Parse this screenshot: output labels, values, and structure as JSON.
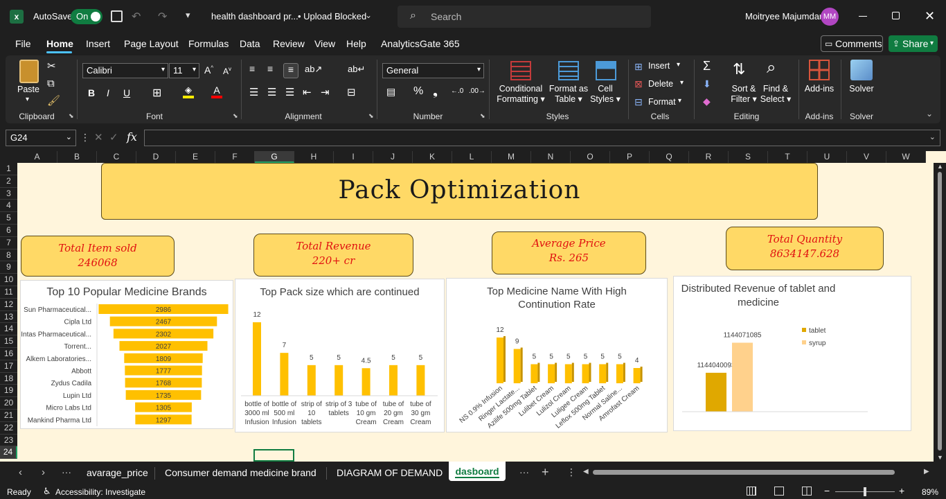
{
  "app": {
    "autosave_label": "AutoSave",
    "autosave_state": "On",
    "file_title": "health dashboard pr...",
    "upload_status": "• Upload Blocked",
    "search_placeholder": "Search",
    "user_name": "Moitryee Majumdar",
    "user_initials": "MM"
  },
  "menu": [
    "File",
    "Home",
    "Insert",
    "Page Layout",
    "Formulas",
    "Data",
    "Review",
    "View",
    "Help",
    "AnalyticsGate 365"
  ],
  "menu_active": "Home",
  "comments_label": "Comments",
  "share_label": "Share",
  "ribbon": {
    "clipboard": {
      "paste": "Paste",
      "group": "Clipboard"
    },
    "font": {
      "name": "Calibri",
      "size": "11",
      "group": "Font",
      "bold": "B",
      "italic": "I",
      "underline": "U"
    },
    "alignment": {
      "group": "Alignment"
    },
    "number": {
      "format": "General",
      "group": "Number"
    },
    "styles": {
      "cond1": "Conditional",
      "cond2": "Formatting",
      "fmt1": "Format as",
      "fmt2": "Table",
      "cell1": "Cell",
      "cell2": "Styles",
      "group": "Styles"
    },
    "cells": {
      "insert": "Insert",
      "delete": "Delete",
      "format": "Format",
      "group": "Cells"
    },
    "editing": {
      "sort1": "Sort &",
      "sort2": "Filter",
      "find1": "Find &",
      "find2": "Select",
      "group": "Editing"
    },
    "addins": {
      "label": "Add-ins",
      "group": "Add-ins"
    },
    "solver": {
      "label": "Solver",
      "group": "Solver"
    }
  },
  "formula_bar": {
    "name_box": "G24",
    "fx": "fx",
    "value": ""
  },
  "columns": [
    "A",
    "B",
    "C",
    "D",
    "E",
    "F",
    "G",
    "H",
    "I",
    "J",
    "K",
    "L",
    "M",
    "N",
    "O",
    "P",
    "Q",
    "R",
    "S",
    "T",
    "U",
    "V",
    "W"
  ],
  "rows": [
    "1",
    "2",
    "3",
    "4",
    "5",
    "6",
    "7",
    "8",
    "9",
    "10",
    "11",
    "12",
    "13",
    "14",
    "15",
    "16",
    "17",
    "18",
    "19",
    "20",
    "21",
    "22",
    "23",
    "24"
  ],
  "dashboard": {
    "title": "Pack Optimization",
    "kpis": [
      {
        "label": "Total Item sold",
        "value": "246068"
      },
      {
        "label": "Total Revenue",
        "value": "220+ cr"
      },
      {
        "label": "Average Price",
        "value": "Rs. 265"
      },
      {
        "label": "Total Quantity",
        "value": "8634147.628"
      }
    ]
  },
  "chart_data": [
    {
      "type": "bar",
      "orientation": "horizontal",
      "title": "Top 10  Popular Medicine Brands",
      "categories": [
        "Sun Pharmaceutical...",
        "Cipla Ltd",
        "Intas Pharmaceutical...",
        "Torrent...",
        "Alkem Laboratories...",
        "Abbott",
        "Zydus Cadila",
        "Lupin Ltd",
        "Micro Labs Ltd",
        "Mankind Pharma Ltd"
      ],
      "values": [
        2986,
        2467,
        2302,
        2027,
        1809,
        1777,
        1768,
        1735,
        1305,
        1297
      ],
      "color": "#ffc000"
    },
    {
      "type": "bar",
      "title": "Top Pack size which are continued",
      "categories": [
        [
          "bottle of",
          "3000 ml",
          "Infusion"
        ],
        [
          "bottle of",
          "500 ml",
          "Infusion"
        ],
        [
          "strip of",
          "10",
          "tablets"
        ],
        [
          "strip of 3",
          "tablets"
        ],
        [
          "tube of",
          "10 gm",
          "Cream"
        ],
        [
          "tube of",
          "20 gm",
          "Cream"
        ],
        [
          "tube of",
          "30 gm",
          "Cream"
        ]
      ],
      "values": [
        12,
        7,
        5,
        5,
        4.5,
        5,
        5
      ],
      "value_labels": [
        "12",
        "7",
        "5",
        "5",
        "4.5",
        "5",
        "5"
      ],
      "color": "#ffc000"
    },
    {
      "type": "bar",
      "title": "Top Medicine Name With High Continution Rate",
      "title_lines": [
        "Top Medicine Name With High",
        "Continution Rate"
      ],
      "categories": [
        "NS 0.9% Infusion",
        "Ringer Lactate...",
        "Azilife 500mg Tablet",
        "Lulibet Cream",
        "Lulizol Cream",
        "Luligee Cream",
        "Leflox 500mg Tablet",
        "Normal Saline...",
        "Amrofast Cream"
      ],
      "values": [
        12,
        9,
        5,
        5,
        5,
        5,
        5,
        5,
        4
      ],
      "color": "#ffc000"
    },
    {
      "type": "bar",
      "title": "Distributed Revenue of tablet and medicine",
      "title_lines": [
        "Distributed Revenue of tablet and",
        "medicine"
      ],
      "series": [
        {
          "name": "tablet",
          "values": [
            1144040093
          ],
          "color": "#e0a800"
        },
        {
          "name": "syrup",
          "values": [
            1144071085
          ],
          "color": "#ffd18c"
        }
      ],
      "value_labels": [
        "1144040093",
        "1144071085"
      ]
    }
  ],
  "sheet_tabs": [
    "avarage_price",
    "Consumer demand medicine brand",
    "DIAGRAM OF DEMAND",
    "dasboard"
  ],
  "active_tab": "dasboard",
  "status": {
    "ready": "Ready",
    "accessibility": "Accessibility: Investigate",
    "zoom": "89%"
  }
}
